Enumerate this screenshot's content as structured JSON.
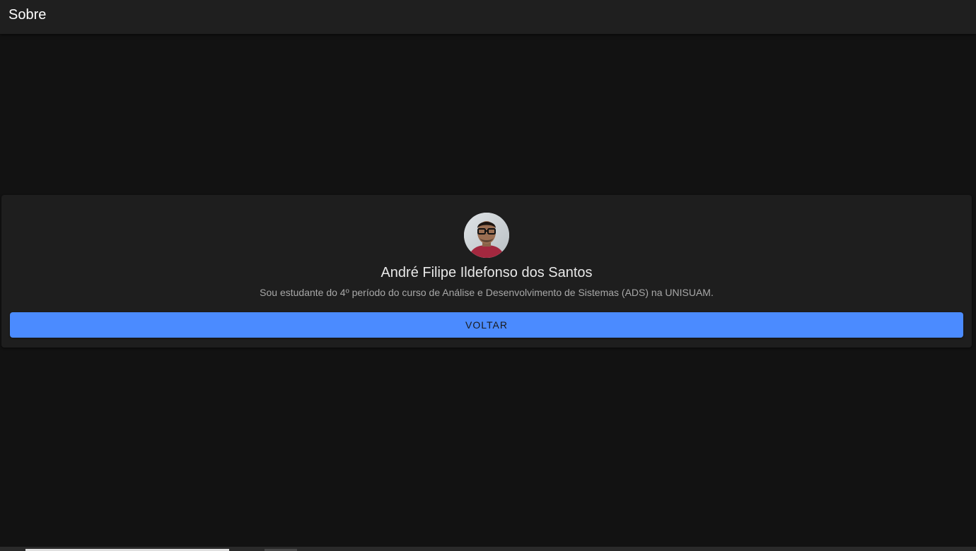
{
  "header": {
    "title": "Sobre"
  },
  "profile": {
    "avatar_icon": "person-photo-avatar",
    "name": "André Filipe Ildefonso dos Santos",
    "description": "Sou estudante do 4º período do curso de Análise e Desenvolvimento de Sistemas (ADS) na UNISUAM.",
    "back_button_label": "VOLTAR"
  },
  "colors": {
    "background": "#121212",
    "topbar": "#1f1f1f",
    "card": "#1e1e1e",
    "button": "#4b8bff"
  }
}
